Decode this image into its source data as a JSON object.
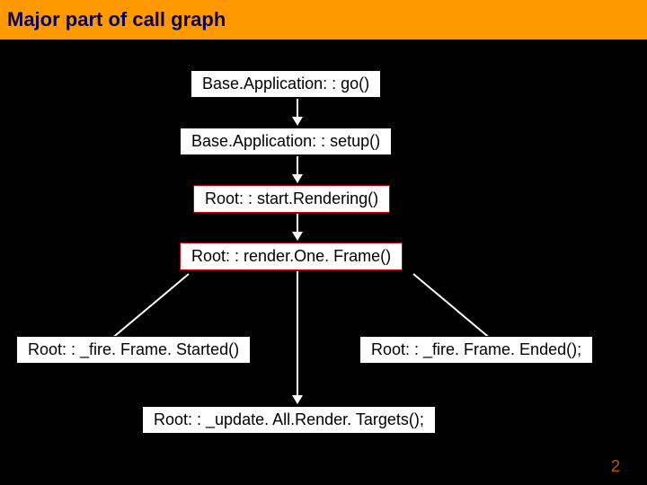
{
  "title": "Major part of call graph",
  "nodes": {
    "go": "Base.Application: : go()",
    "setup": "Base.Application: : setup()",
    "start": "Root: : start.Rendering()",
    "render": "Root: : render.One. Frame()",
    "started": "Root: : _fire. Frame. Started()",
    "ended": "Root: : _fire. Frame. Ended();",
    "update": "Root: : _update. All.Render. Targets();"
  },
  "page_number": "2"
}
